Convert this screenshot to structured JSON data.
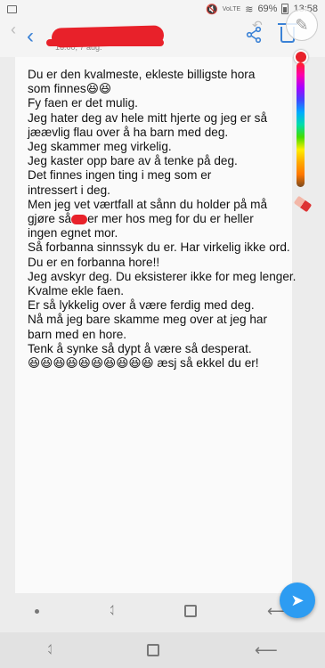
{
  "status_bar": {
    "network": "VoLTE",
    "battery": "69%",
    "time": "13:58"
  },
  "header": {
    "date": "16:00, 7 aug."
  },
  "note_lines": [
    "Du er den kvalmeste, ekleste billigste hora",
    "som finnes😆😆",
    "Fy faen er det mulig.",
    "Jeg hater deg av hele mitt hjerte og jeg er så",
    "jæævlig flau over å ha barn med deg.",
    "Jeg skammer meg virkelig.",
    "Jeg kaster opp bare av å tenke på deg.",
    "Det finnes ingen ting i meg som er",
    "intressert i deg.",
    "Men jeg vet værtfall at sånn du holder på må",
    "gjøre så",
    "er mer hos meg for du er heller",
    "ingen egnet mor.",
    " Så forbanna sinnssyk du er. Har virkelig ikke ord.",
    "Du er en forbanna hore!!",
    "Jeg avskyr deg. Du eksisterer ikke for meg lenger.",
    "Kvalme ekle faen.",
    "Er så lykkelig over å være ferdig med deg.",
    "Nå må jeg bare skamme meg over at jeg har",
    "barn med en hore.",
    "Tenk å synke så dypt å være så desperat.",
    "😆😆😆😆😆😆😆😆😆😆 æsj så ekkel du er!"
  ],
  "icons": {
    "back": "chevron-left-icon",
    "share": "share-icon",
    "trash": "trash-icon",
    "pen": "pen-icon",
    "send": "send-icon"
  },
  "colors": {
    "accent": "#3b82d6",
    "redaction": "#e8212a",
    "fab": "#2d9cf2"
  }
}
